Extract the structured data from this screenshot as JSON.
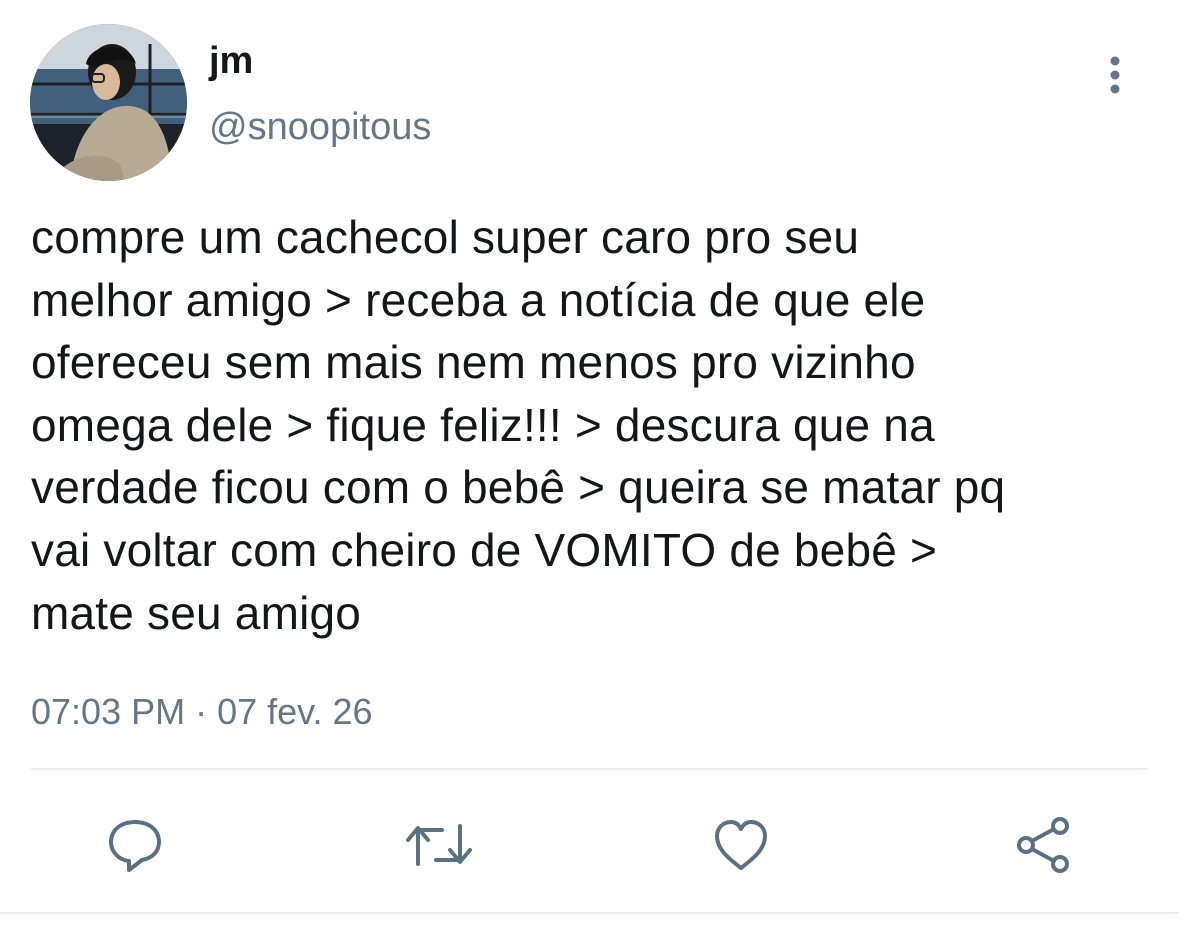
{
  "tweet": {
    "author_name": "jm",
    "author_handle": "@snoopitous",
    "text": "compre um cachecol super caro pro seu\nmelhor amigo > receba a notícia de que ele\nofereceu sem mais nem menos pro vizinho\nomega dele > fique feliz!!! > descura que na\nverdade ficou com o bebê > queira se matar pq\nvai voltar com cheiro de VOMITO de bebê >\nmate seu amigo",
    "timestamp": "07:03 PM · 07 fev. 26"
  },
  "icons": {
    "more": "more-vertical-icon",
    "reply": "reply-icon",
    "retweet": "retweet-icon",
    "like": "heart-icon",
    "share": "share-icon"
  },
  "colors": {
    "text": "#14171a",
    "secondary": "#657786",
    "action_icon": "#5b7083",
    "divider": "#e6ecf0"
  }
}
